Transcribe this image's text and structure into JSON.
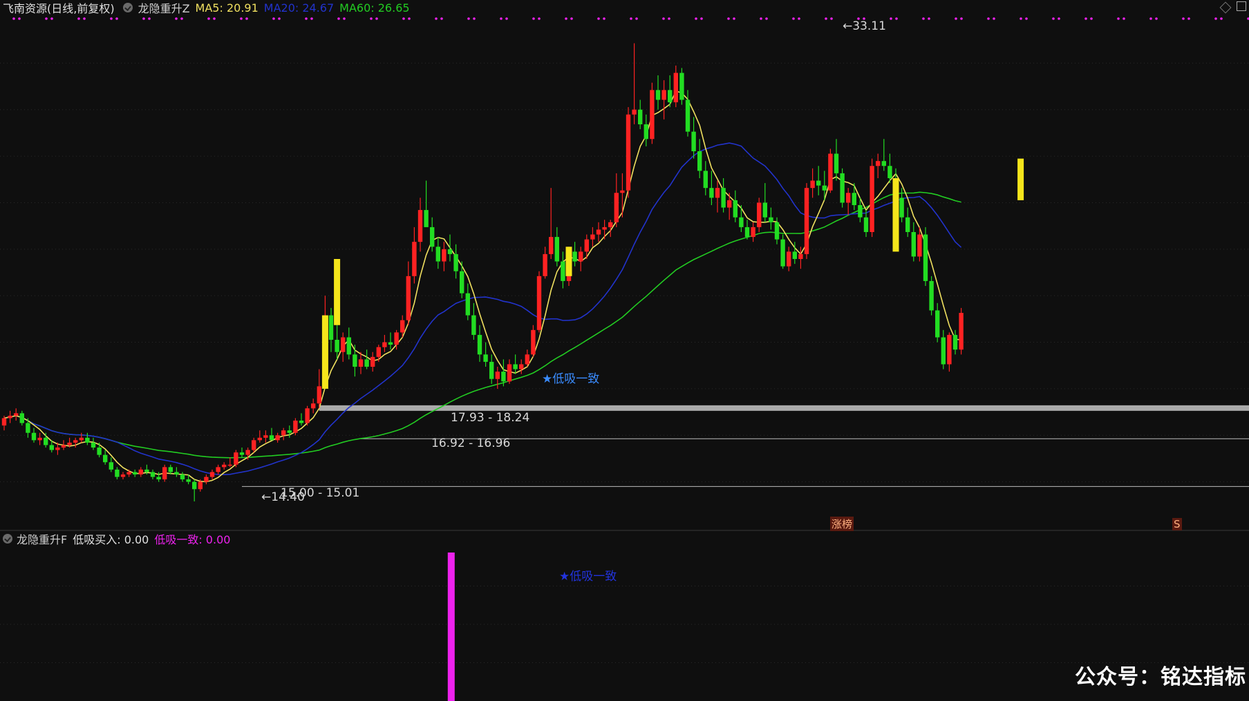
{
  "header": {
    "stock": "飞南资源(日线,前复权)",
    "indicator": "龙隐重升Z",
    "ma5": "MA5: 20.91",
    "ma20": "MA20: 24.67",
    "ma60": "MA60: 26.65"
  },
  "sub_header": {
    "indicator": "龙隐重升F",
    "buy": "低吸买入: 0.00",
    "signal": "低吸一致: 0.00"
  },
  "annotations": {
    "high_label": "33.11",
    "low_label": "14.40",
    "signal_label": "★低吸一致",
    "sub_signal_label": "★低吸一致",
    "zone1": "17.93 - 18.24",
    "zone2": "16.92 - 16.96",
    "zone3": "15.00 - 15.01",
    "tag1": "涨榜",
    "tag2": "S"
  },
  "watermark": "公众号：铭达指标",
  "colors": {
    "up": "#ff2222",
    "down": "#22dd22",
    "signal_yellow": "#f5e51b",
    "ma5": "#f0e060",
    "ma20": "#2233cc",
    "ma60": "#22cc22",
    "magenta": "#ee22ee",
    "zone_band": "#aaaaaa"
  },
  "chart_data": {
    "type": "candlestick",
    "title": "飞南资源(日线,前复权)",
    "ylim": [
      13.3,
      34.2
    ],
    "candles": [
      [
        17.5,
        17.9,
        17.3,
        17.8
      ],
      [
        17.8,
        18.1,
        17.6,
        17.9
      ],
      [
        17.9,
        18.2,
        17.7,
        18.0
      ],
      [
        18.0,
        18.1,
        17.5,
        17.6
      ],
      [
        17.6,
        17.8,
        17.0,
        17.2
      ],
      [
        17.2,
        17.4,
        16.8,
        16.9
      ],
      [
        16.9,
        17.2,
        16.7,
        17.0
      ],
      [
        17.0,
        17.2,
        16.6,
        16.7
      ],
      [
        16.7,
        16.9,
        16.4,
        16.5
      ],
      [
        16.5,
        16.8,
        16.3,
        16.6
      ],
      [
        16.6,
        16.9,
        16.5,
        16.7
      ],
      [
        16.7,
        17.0,
        16.6,
        16.8
      ],
      [
        16.8,
        17.0,
        16.6,
        16.9
      ],
      [
        16.9,
        17.2,
        16.8,
        17.0
      ],
      [
        17.0,
        17.2,
        16.7,
        16.8
      ],
      [
        16.8,
        17.0,
        16.5,
        16.6
      ],
      [
        16.6,
        16.8,
        16.2,
        16.3
      ],
      [
        16.3,
        16.5,
        15.9,
        16.0
      ],
      [
        16.0,
        16.2,
        15.6,
        15.7
      ],
      [
        15.7,
        15.8,
        15.3,
        15.4
      ],
      [
        15.4,
        15.6,
        15.3,
        15.5
      ],
      [
        15.5,
        15.7,
        15.4,
        15.6
      ],
      [
        15.6,
        15.7,
        15.4,
        15.5
      ],
      [
        15.5,
        15.8,
        15.4,
        15.7
      ],
      [
        15.7,
        15.9,
        15.5,
        15.6
      ],
      [
        15.6,
        15.7,
        15.3,
        15.4
      ],
      [
        15.4,
        15.6,
        15.2,
        15.3
      ],
      [
        15.3,
        15.9,
        15.2,
        15.8
      ],
      [
        15.8,
        15.9,
        15.5,
        15.6
      ],
      [
        15.6,
        15.8,
        15.4,
        15.5
      ],
      [
        15.5,
        15.6,
        15.2,
        15.3
      ],
      [
        15.3,
        15.5,
        15.1,
        15.2
      ],
      [
        15.2,
        15.3,
        14.4,
        14.9
      ],
      [
        14.9,
        15.3,
        14.8,
        15.2
      ],
      [
        15.2,
        15.5,
        15.1,
        15.4
      ],
      [
        15.4,
        15.7,
        15.3,
        15.6
      ],
      [
        15.6,
        15.9,
        15.5,
        15.8
      ],
      [
        15.8,
        16.0,
        15.7,
        15.9
      ],
      [
        15.9,
        16.2,
        15.8,
        15.9
      ],
      [
        15.9,
        16.5,
        15.8,
        16.4
      ],
      [
        16.4,
        16.6,
        16.2,
        16.3
      ],
      [
        16.3,
        16.6,
        16.1,
        16.5
      ],
      [
        16.5,
        17.0,
        16.4,
        16.9
      ],
      [
        16.9,
        17.3,
        16.8,
        17.0
      ],
      [
        17.0,
        17.3,
        16.8,
        17.1
      ],
      [
        17.1,
        17.4,
        16.9,
        16.9
      ],
      [
        16.9,
        17.2,
        16.8,
        17.1
      ],
      [
        17.1,
        17.4,
        16.9,
        17.3
      ],
      [
        17.3,
        17.5,
        17.0,
        17.2
      ],
      [
        17.2,
        17.8,
        17.1,
        17.7
      ],
      [
        17.7,
        18.0,
        17.5,
        17.6
      ],
      [
        17.6,
        18.3,
        17.5,
        18.2
      ],
      [
        18.2,
        18.6,
        18.0,
        18.4
      ],
      [
        18.4,
        19.8,
        18.2,
        19.1
      ],
      [
        19.1,
        22.8,
        19.0,
        22.0
      ],
      [
        22.0,
        22.3,
        20.5,
        21.0
      ],
      [
        21.0,
        21.6,
        20.2,
        20.5
      ],
      [
        20.5,
        21.3,
        20.1,
        21.1
      ],
      [
        21.1,
        21.5,
        20.2,
        20.4
      ],
      [
        20.4,
        20.8,
        19.5,
        19.9
      ],
      [
        19.9,
        20.5,
        19.6,
        20.2
      ],
      [
        20.2,
        20.6,
        19.8,
        19.9
      ],
      [
        19.9,
        20.5,
        19.7,
        20.3
      ],
      [
        20.3,
        20.8,
        20.1,
        20.7
      ],
      [
        20.7,
        21.2,
        20.5,
        20.9
      ],
      [
        20.9,
        21.3,
        20.6,
        20.8
      ],
      [
        20.8,
        21.4,
        20.6,
        21.3
      ],
      [
        21.3,
        22.0,
        21.1,
        21.8
      ],
      [
        21.8,
        24.2,
        21.6,
        23.6
      ],
      [
        23.6,
        25.6,
        23.3,
        25.0
      ],
      [
        25.0,
        26.8,
        24.6,
        26.3
      ],
      [
        26.3,
        27.5,
        25.8,
        25.6
      ],
      [
        25.6,
        26.0,
        24.6,
        24.8
      ],
      [
        24.8,
        25.2,
        23.9,
        24.2
      ],
      [
        24.2,
        25.0,
        23.8,
        24.7
      ],
      [
        24.7,
        25.3,
        24.2,
        24.5
      ],
      [
        24.5,
        24.9,
        23.5,
        23.8
      ],
      [
        23.8,
        24.2,
        22.7,
        22.9
      ],
      [
        22.9,
        23.3,
        21.8,
        22.0
      ],
      [
        22.0,
        22.5,
        21.0,
        21.2
      ],
      [
        21.2,
        21.6,
        20.1,
        20.4
      ],
      [
        20.4,
        20.9,
        19.9,
        20.1
      ],
      [
        20.1,
        20.4,
        19.2,
        19.4
      ],
      [
        19.4,
        19.9,
        19.0,
        19.7
      ],
      [
        19.7,
        20.2,
        19.1,
        19.3
      ],
      [
        19.3,
        20.2,
        19.2,
        20.0
      ],
      [
        20.0,
        20.4,
        19.6,
        19.8
      ],
      [
        19.8,
        20.2,
        19.6,
        20.0
      ],
      [
        20.0,
        20.6,
        19.9,
        20.4
      ],
      [
        20.4,
        21.6,
        20.3,
        21.4
      ],
      [
        21.4,
        23.8,
        21.3,
        23.6
      ],
      [
        23.6,
        24.8,
        23.5,
        24.5
      ],
      [
        24.5,
        27.2,
        24.3,
        25.2
      ],
      [
        25.2,
        25.6,
        24.0,
        24.2
      ],
      [
        24.2,
        24.6,
        23.1,
        23.4
      ],
      [
        23.4,
        24.8,
        23.2,
        24.6
      ],
      [
        24.6,
        25.0,
        24.0,
        24.2
      ],
      [
        24.2,
        24.8,
        23.8,
        24.6
      ],
      [
        24.6,
        25.3,
        24.3,
        25.1
      ],
      [
        25.1,
        25.6,
        24.8,
        25.3
      ],
      [
        25.3,
        25.8,
        25.0,
        25.5
      ],
      [
        25.5,
        25.9,
        25.1,
        25.6
      ],
      [
        25.6,
        25.9,
        25.2,
        25.8
      ],
      [
        25.8,
        27.8,
        25.6,
        27.0
      ],
      [
        27.0,
        27.8,
        26.0,
        27.1
      ],
      [
        27.1,
        30.5,
        26.8,
        30.2
      ],
      [
        30.2,
        33.11,
        29.8,
        30.4
      ],
      [
        30.4,
        30.8,
        29.6,
        29.8
      ],
      [
        29.8,
        30.2,
        28.9,
        29.2
      ],
      [
        29.2,
        31.5,
        29.0,
        31.2
      ],
      [
        31.2,
        31.8,
        30.4,
        30.8
      ],
      [
        30.8,
        31.6,
        30.0,
        31.2
      ],
      [
        31.2,
        31.8,
        30.5,
        30.7
      ],
      [
        30.7,
        32.2,
        30.5,
        31.9
      ],
      [
        31.9,
        32.1,
        30.6,
        30.8
      ],
      [
        30.8,
        31.2,
        29.3,
        29.5
      ],
      [
        29.5,
        30.1,
        28.4,
        28.7
      ],
      [
        28.7,
        29.2,
        27.6,
        27.9
      ],
      [
        27.9,
        28.3,
        26.9,
        27.2
      ],
      [
        27.2,
        27.9,
        26.5,
        26.8
      ],
      [
        26.8,
        27.5,
        26.2,
        27.2
      ],
      [
        27.2,
        27.6,
        26.2,
        26.4
      ],
      [
        26.4,
        27.0,
        25.9,
        26.7
      ],
      [
        26.7,
        27.1,
        25.8,
        26.0
      ],
      [
        26.0,
        26.5,
        25.4,
        25.6
      ],
      [
        25.6,
        25.9,
        25.1,
        25.2
      ],
      [
        25.2,
        25.8,
        25.0,
        25.6
      ],
      [
        25.6,
        26.8,
        25.4,
        26.6
      ],
      [
        26.6,
        27.4,
        25.8,
        26.0
      ],
      [
        26.0,
        26.4,
        25.5,
        25.8
      ],
      [
        25.8,
        26.0,
        24.9,
        25.1
      ],
      [
        25.1,
        25.3,
        23.9,
        24.0
      ],
      [
        24.0,
        24.8,
        23.8,
        24.6
      ],
      [
        24.6,
        25.0,
        24.1,
        24.3
      ],
      [
        24.3,
        24.8,
        23.9,
        24.5
      ],
      [
        24.5,
        27.4,
        24.3,
        27.2
      ],
      [
        27.2,
        28.0,
        26.8,
        27.5
      ],
      [
        27.5,
        28.1,
        26.9,
        27.3
      ],
      [
        27.3,
        27.9,
        26.7,
        27.1
      ],
      [
        27.1,
        28.8,
        27.0,
        28.6
      ],
      [
        28.6,
        29.2,
        27.5,
        27.8
      ],
      [
        27.8,
        28.0,
        26.4,
        26.6
      ],
      [
        26.6,
        27.2,
        26.1,
        27.0
      ],
      [
        27.0,
        27.4,
        26.3,
        26.5
      ],
      [
        26.5,
        26.8,
        25.8,
        26.0
      ],
      [
        26.0,
        26.3,
        25.2,
        25.4
      ],
      [
        25.4,
        28.4,
        25.2,
        28.1
      ],
      [
        28.1,
        28.6,
        27.6,
        28.3
      ],
      [
        28.3,
        29.2,
        27.9,
        28.1
      ],
      [
        28.1,
        28.6,
        27.4,
        27.6
      ],
      [
        27.6,
        28.0,
        26.6,
        26.8
      ],
      [
        26.8,
        27.2,
        25.8,
        26.0
      ],
      [
        26.0,
        26.4,
        25.2,
        25.4
      ],
      [
        25.4,
        25.8,
        24.2,
        24.4
      ],
      [
        24.4,
        25.6,
        24.2,
        25.3
      ],
      [
        25.3,
        25.6,
        23.2,
        23.4
      ],
      [
        23.4,
        23.6,
        22.0,
        22.2
      ],
      [
        22.2,
        22.5,
        20.9,
        21.1
      ],
      [
        21.1,
        21.4,
        19.8,
        20.0
      ],
      [
        20.0,
        21.3,
        19.7,
        21.2
      ],
      [
        21.2,
        21.4,
        20.4,
        20.6
      ],
      [
        20.6,
        22.3,
        20.4,
        22.1
      ]
    ],
    "signals_yellow": [
      [
        54,
        19.0,
        22.0
      ],
      [
        56,
        21.6,
        24.3
      ],
      [
        95,
        23.6,
        24.8
      ],
      [
        150,
        24.6,
        27.6
      ],
      [
        171,
        26.7,
        28.4
      ]
    ],
    "zones": [
      {
        "label": "17.93 - 18.24",
        "low": 17.93,
        "high": 18.24
      },
      {
        "label": "16.92 - 16.96",
        "low": 16.92,
        "high": 16.96
      },
      {
        "label": "15.00 - 15.01",
        "low": 15.0,
        "high": 15.01
      }
    ],
    "sub_signal_index": 73
  }
}
